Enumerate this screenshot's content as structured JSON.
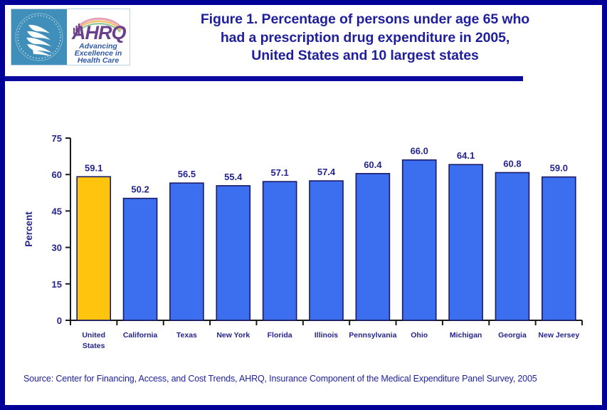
{
  "figure": {
    "title_lines": [
      "Figure 1. Percentage of persons under age 65 who",
      "had a prescription drug expenditure in 2005,",
      "United States and 10 largest states"
    ],
    "source": "Source: Center for Financing, Access, and Cost Trends, AHRQ, Insurance Component of the Medical Expenditure Panel Survey, 2005"
  },
  "logo": {
    "agency_acronym": "AHRQ",
    "tagline_lines": [
      "Advancing",
      "Excellence in",
      "Health Care"
    ],
    "seal_text": "DEPARTMENT OF HEALTH & HUMAN SERVICES · USA"
  },
  "colors": {
    "navy_border": "#000099",
    "rule": "#0a0a9e",
    "title_text": "#1f1f9c",
    "highlight_bar": "#ffc40d",
    "bar": "#3c6ff0",
    "bar_outline": "#1a1a66",
    "axis": "#1a1a1a",
    "label_text": "#24248f",
    "seal_blue": "#3f8fba",
    "ahrq_purple": "#6b3f8c"
  },
  "chart_data": {
    "type": "bar",
    "title": "Figure 1. Percentage of persons under age 65 who had a prescription drug expenditure in 2005, United States and 10 largest states",
    "xlabel": "",
    "ylabel": "Percent",
    "ylim": [
      0,
      75
    ],
    "yticks": [
      0,
      15,
      30,
      45,
      60,
      75
    ],
    "ytick_labels": [
      "0",
      "15",
      "30",
      "45",
      "60",
      "75"
    ],
    "grid": false,
    "legend": "none",
    "categories": [
      "United States",
      "California",
      "Texas",
      "New York",
      "Florida",
      "Illinois",
      "Pennsylvania",
      "Ohio",
      "Michigan",
      "Georgia",
      "New Jersey"
    ],
    "category_label_lines": [
      [
        "United",
        "States"
      ],
      [
        "California"
      ],
      [
        "Texas"
      ],
      [
        "New York"
      ],
      [
        "Florida"
      ],
      [
        "Illinois"
      ],
      [
        "Pennsylvania"
      ],
      [
        "Ohio"
      ],
      [
        "Michigan"
      ],
      [
        "Georgia"
      ],
      [
        "New Jersey"
      ]
    ],
    "values": [
      59.1,
      50.2,
      56.5,
      55.4,
      57.1,
      57.4,
      60.4,
      66.0,
      64.1,
      60.8,
      59.0
    ],
    "value_labels": [
      "59.1",
      "50.2",
      "56.5",
      "55.4",
      "57.1",
      "57.4",
      "60.4",
      "66.0",
      "64.1",
      "60.8",
      "59.0"
    ],
    "bar_colors": [
      "#ffc40d",
      "#3c6ff0",
      "#3c6ff0",
      "#3c6ff0",
      "#3c6ff0",
      "#3c6ff0",
      "#3c6ff0",
      "#3c6ff0",
      "#3c6ff0",
      "#3c6ff0",
      "#3c6ff0"
    ]
  }
}
